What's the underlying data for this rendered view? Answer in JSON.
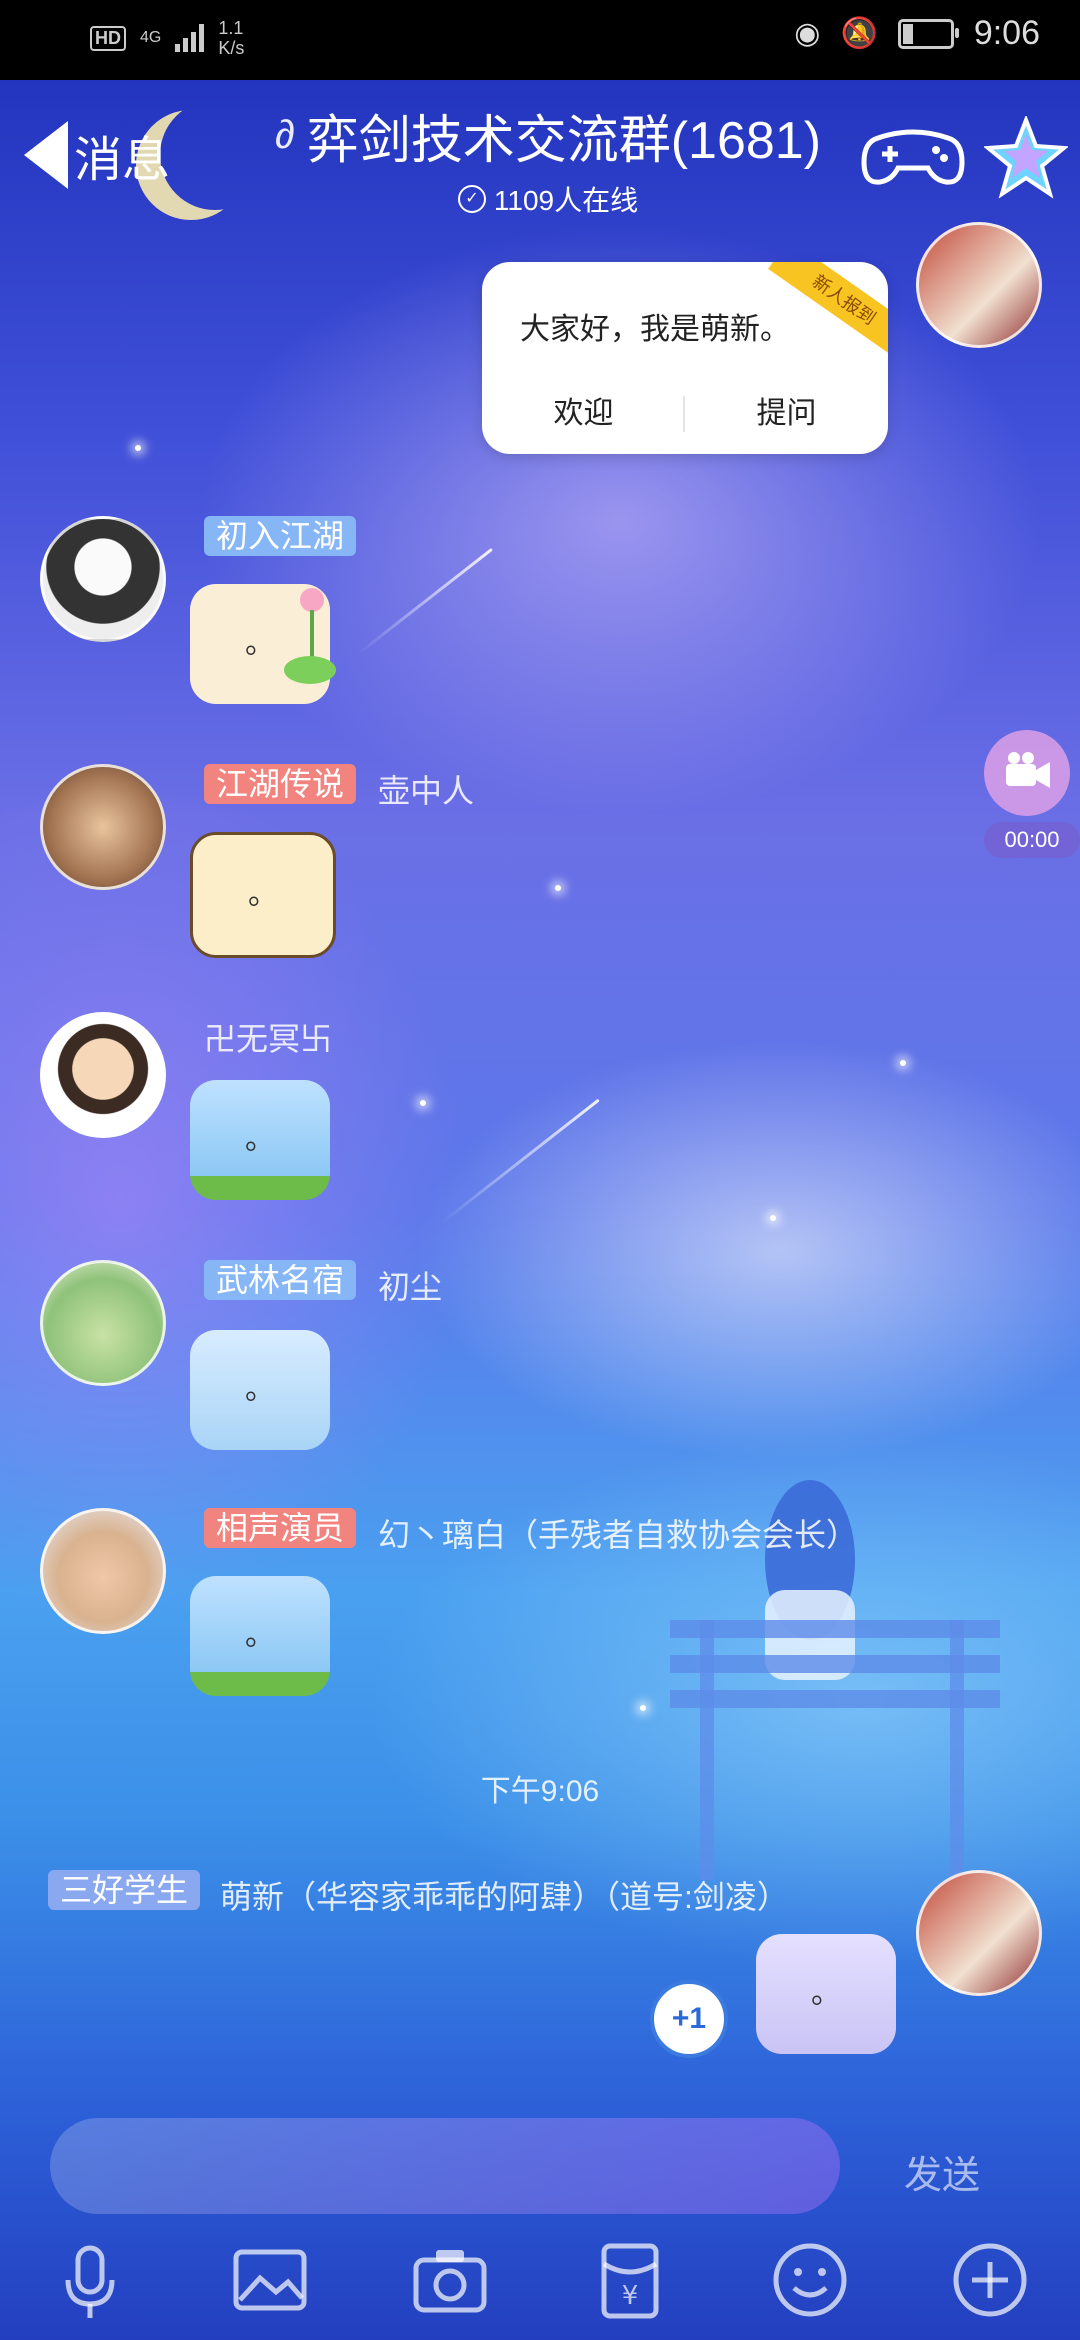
{
  "status_bar": {
    "hd": "HD",
    "network": "4G",
    "speed_value": "1.1",
    "speed_unit": "K/s",
    "time": "9:06"
  },
  "header": {
    "back_label": "消息",
    "group_title": "弈剑技术交流群(1681)",
    "online_text": "1109人在线"
  },
  "new_member_card": {
    "ribbon": "新人报到",
    "message": "大家好，我是萌新。",
    "welcome_label": "欢迎",
    "ask_label": "提问"
  },
  "messages": [
    {
      "tag": "初入江湖",
      "tag_color": "#86b6f5",
      "nickname": "",
      "bubble": "。"
    },
    {
      "tag": "江湖传说",
      "tag_color": "#f2847f",
      "nickname": "壶中人",
      "bubble": "。"
    },
    {
      "tag": "",
      "tag_color": "",
      "nickname": "卍无冥卐",
      "bubble": "。"
    },
    {
      "tag": "武林名宿",
      "tag_color": "#86b6f5",
      "nickname": "初尘",
      "bubble": "。"
    },
    {
      "tag": "相声演员",
      "tag_color": "#f2847f",
      "nickname": "幻丶璃白（手残者自救协会会长）",
      "bubble": "。"
    }
  ],
  "timestamp": "下午9:06",
  "self_message": {
    "tag": "三好学生",
    "tag_color": "#8aa8f0",
    "nickname": "萌新（华容家乖乖的阿肆）（道号:剑凌）",
    "bubble": "。",
    "plus_one": "+1"
  },
  "video": {
    "time": "00:00"
  },
  "input": {
    "send_label": "发送"
  },
  "toolbar": {
    "items": [
      "mic-icon",
      "image-icon",
      "camera-icon",
      "red-packet-icon",
      "emoji-icon",
      "plus-icon"
    ]
  },
  "colors": {
    "tag_blue": "#86b6f5",
    "tag_red": "#f2847f",
    "online_blue": "#3b7be0"
  }
}
